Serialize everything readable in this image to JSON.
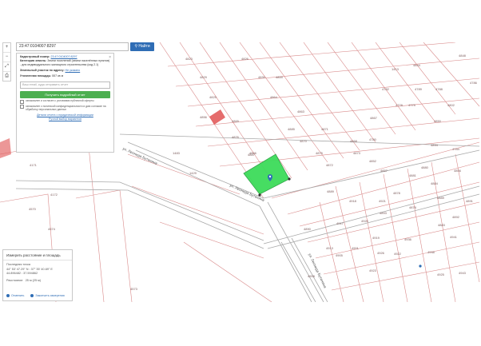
{
  "search": {
    "value": "23:47:0104007:8297",
    "button_label": "Найти"
  },
  "toolbar": {
    "zoom_in": "+",
    "zoom_out": "−",
    "fullscreen": "⤢",
    "print": "⎙"
  },
  "info_panel": {
    "close": "×",
    "cadastral_label": "Кадастровый номер:",
    "cadastral_value": "23:47:0104007:8297",
    "category_label": "Категория земель:",
    "category_value": "Земли поселений (земли населённых пунктов)",
    "use_value": "- для индивидуального жилищного строительства (код 2.1)",
    "address_label": "Земельный участок по адресу:",
    "address_value": "Не указано",
    "area_label": "Уточненная площадь:",
    "area_value": "557 кв м",
    "email_placeholder": "Ваш email, куда отправить отчет",
    "report_button": "Получить подробный отчет",
    "consent_1": "ознакомлен и согласен с условиями публичной оферты",
    "consent_2": "ознакомлен с политикой конфиденциальности и даю согласие на обработку персональных данных",
    "link_1": "Детали отчета о юридической информации",
    "link_2": "Ручной выбор вариантов"
  },
  "measure": {
    "title": "Измерить расстояние и площадь",
    "last_point_label": "Последняя точка",
    "coords_dms": "44° 53' 47.29\" N : 37° 35' 40.69\" E",
    "coords_dec": "44.896482 : 37.594862",
    "distance_label": "Расстояние",
    "distance_value": "25 м (25 м)",
    "cancel": "Отменить",
    "finish": "Закончить измерения"
  },
  "map": {
    "streets": [
      "ул. Леонида Бутенина",
      "ул. Леонида Бутенина",
      "ул. Леонида Бутенина"
    ],
    "parcels": [
      "4823",
      "4826",
      "4829",
      "4830",
      "4825",
      "4859",
      "4856",
      "4864",
      "4865",
      "4863",
      "4876",
      "4887",
      "4885",
      "4870",
      "4871",
      "4875",
      "4872",
      "4866",
      "4868",
      "4873",
      "4867",
      "4780",
      "4782",
      "4778",
      "4789",
      "4779",
      "4788",
      "4802",
      "4786",
      "4852",
      "4857",
      "4881",
      "4878",
      "4884",
      "4889",
      "4892",
      "4883",
      "4878",
      "4893",
      "4880",
      "4856",
      "4894",
      "4891",
      "4889",
      "4918",
      "4921",
      "4920",
      "4917",
      "4919",
      "4926",
      "4901",
      "4905",
      "4908",
      "4923",
      "4922",
      "4936",
      "4938",
      "4941",
      "4925",
      "4943",
      "4890",
      "4913",
      "1483",
      "1429",
      "4171",
      "4172",
      "4570",
      "4574",
      "4573",
      "4146",
      "1413",
      "4844",
      "4848",
      "4850",
      "4784",
      "4790"
    ],
    "accent": "#3ddc5a"
  }
}
